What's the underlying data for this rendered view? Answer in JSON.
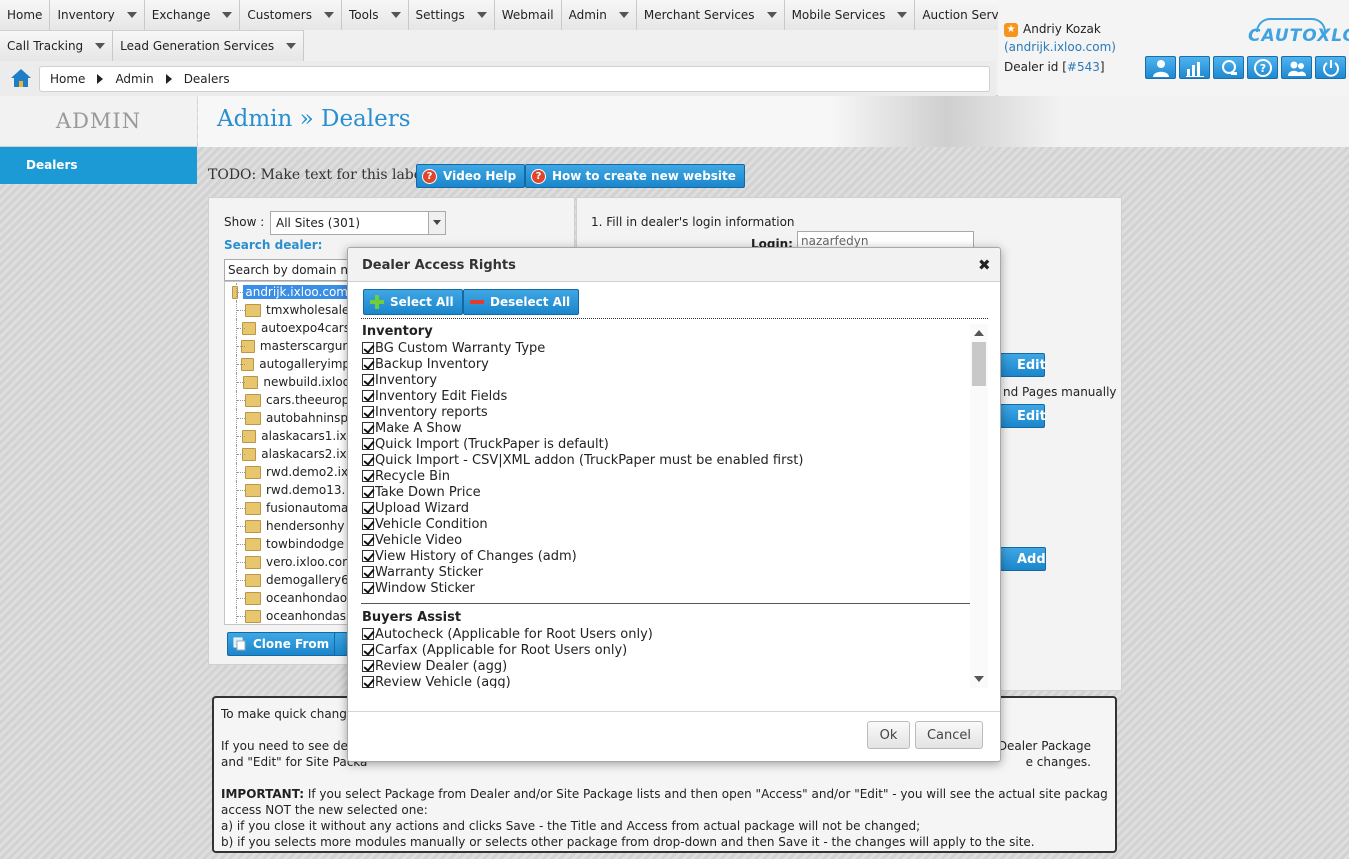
{
  "menu": {
    "row1": [
      {
        "label": "Home",
        "caret": false
      },
      {
        "label": "Inventory",
        "caret": true
      },
      {
        "label": "Exchange",
        "caret": true
      },
      {
        "label": "Customers",
        "caret": true
      },
      {
        "label": "Tools",
        "caret": true
      },
      {
        "label": "Settings",
        "caret": true
      },
      {
        "label": "Webmail",
        "caret": false
      },
      {
        "label": "Admin",
        "caret": true
      },
      {
        "label": "Merchant Services",
        "caret": true
      },
      {
        "label": "Mobile Services",
        "caret": true
      },
      {
        "label": "Auction Services",
        "caret": true
      }
    ],
    "row2": [
      {
        "label": "Call Tracking",
        "caret": true
      },
      {
        "label": "Lead Generation Services",
        "caret": true
      }
    ]
  },
  "breadcrumb": [
    "Home",
    "Admin",
    "Dealers"
  ],
  "user": {
    "name": "Andriy Kozak",
    "domain": "(andrijk.ixloo.com)",
    "dealer_id_prefix": "Dealer id [",
    "dealer_id": "#543",
    "dealer_id_suffix": "]"
  },
  "logo": "CAUTOXLOO",
  "toolbar_icons": [
    "user-icon",
    "chart-icon",
    "support-icon",
    "help-icon",
    "users-icon",
    "power-icon"
  ],
  "sidebar": {
    "heading": "ADMIN",
    "items": [
      {
        "label": "Dealers"
      }
    ]
  },
  "page": {
    "title": "Admin » Dealers",
    "todo_label": "TODO: Make text for this label",
    "video_help": "Video Help",
    "how_to": "How to create new website"
  },
  "left_panel": {
    "show_label": "Show :",
    "show_value": "All Sites (301)",
    "search_label": "Search dealer:",
    "search_placeholder": "Search by domain name",
    "sites": [
      "andrijk.ixloo.com",
      "tmxwholesale",
      "autoexpo4cars",
      "masterscargun",
      "autogalleryimp",
      "newbuild.ixloo",
      "cars.theeurop",
      "autobahninsp",
      "alaskacars1.ixl",
      "alaskacars2.ixl",
      "rwd.demo2.ix",
      "rwd.demo13.",
      "fusionautoma",
      "hendersonhy",
      "towbindodge",
      "vero.ixloo.cor",
      "demogallery6",
      "oceanhondao",
      "oceanhondas"
    ],
    "clone_button": "Clone From"
  },
  "right_panel": {
    "step": "1. Fill in dealer's login information",
    "login_label": "Login:",
    "login_value": "nazarfedyn",
    "edit_label": "Edit",
    "pages_text": "nd Pages manually",
    "add_label": "Add"
  },
  "notes": {
    "line1": "To make quick changes",
    "line2a": "If you need to see det",
    "line2b": "Dealer Package",
    "line3a": "and \"Edit\" for Site Packa",
    "line3b": "e changes.",
    "important_label": "IMPORTANT:",
    "important_text": " If you select Package from Dealer and/or Site Package lists and then open \"Access\" and/or \"Edit\" - you will see the actual site package with actual",
    "line5": "access NOT the new selected one:",
    "line6": "a) if you close it without any actions and clicks Save - the Title and Access from actual package will not be changed;",
    "line7": "b) if you selects more modules manually or selects other package from drop-down and then Save it - the changes will apply to the site."
  },
  "modal": {
    "title": "Dealer Access Rights",
    "select_all": "Select All",
    "deselect_all": "Deselect All",
    "groups": [
      {
        "name": "Inventory",
        "items": [
          "BG Custom Warranty Type",
          "Backup Inventory",
          "Inventory",
          "Inventory Edit Fields",
          "Inventory reports",
          "Make A Show",
          "Quick Import (TruckPaper is default)",
          "Quick Import - CSV|XML addon (TruckPaper must be enabled first)",
          "Recycle Bin",
          "Take Down Price",
          "Upload Wizard",
          "Vehicle Condition",
          "Vehicle Video",
          "View History of Changes (adm)",
          "Warranty Sticker",
          "Window Sticker"
        ]
      },
      {
        "name": "Buyers Assist",
        "items": [
          "Autocheck (Applicable for Root Users only)",
          "Carfax (Applicable for Root Users only)",
          "Review Dealer (agg)",
          "Review Vehicle (agg)"
        ]
      }
    ],
    "ok": "Ok",
    "cancel": "Cancel"
  }
}
